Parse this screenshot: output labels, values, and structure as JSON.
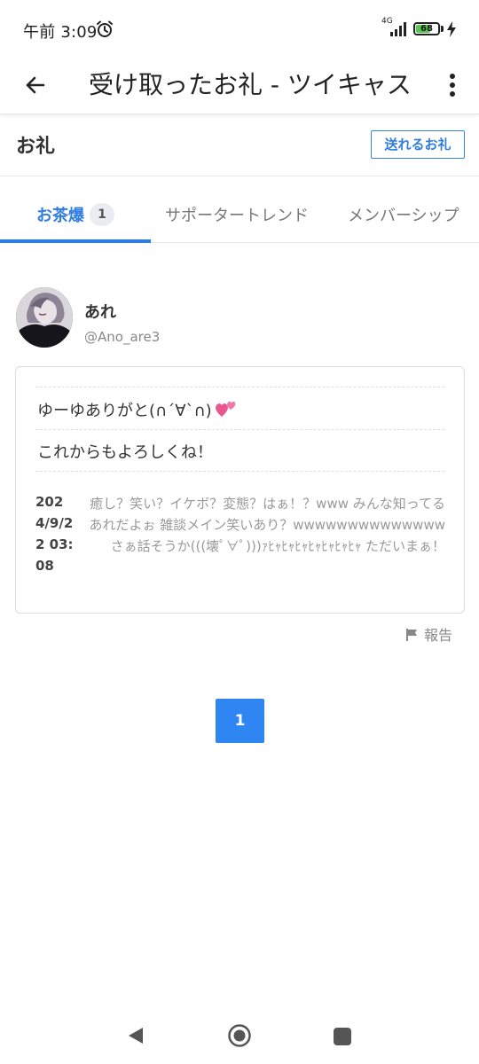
{
  "status": {
    "time": "午前 3:09",
    "network": "4G",
    "battery": "68",
    "battery_level": 0.68
  },
  "appbar": {
    "title": "受け取ったお礼 - ツイキャス",
    "back_icon": "arrow-left-icon",
    "menu_icon": "more-vertical-icon"
  },
  "section": {
    "title": "お礼",
    "send_button": "送れるお礼"
  },
  "tabs": [
    {
      "label": "お茶爆",
      "badge": "1",
      "active": true
    },
    {
      "label": "サポータートレンド",
      "active": false
    },
    {
      "label": "メンバーシップ",
      "active": false
    }
  ],
  "user": {
    "name": "あれ",
    "handle": "@Ano_are3"
  },
  "card": {
    "message1": "ゆーゆありがと(∩´∀`∩)",
    "message2": "これからもよろしくね！",
    "date": "2024/9/22 03:08",
    "description": "癒し？笑い？イケボ？変態？はぁ！？www みんな知ってるあれだよぉ 雑談メイン笑いあり？wwwwwwwwwwwwww さぁ話そうか(((壊ﾟ∀ﾟ)))ｧﾋｬﾋｬﾋｬﾋｬﾋｬﾋｬﾋｬ ただいまぁ！"
  },
  "report_label": "報告",
  "pagination": {
    "current": "1"
  },
  "colors": {
    "accent": "#2f7de1",
    "page_button": "#2f86f2",
    "battery": "#57c84d",
    "heart": "#e8578f"
  }
}
